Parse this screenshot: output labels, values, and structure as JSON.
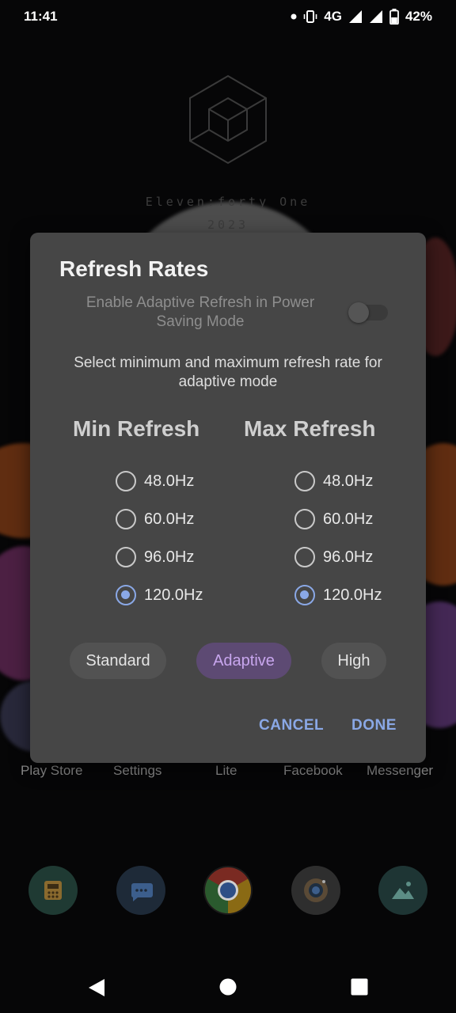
{
  "status_bar": {
    "time": "11:41",
    "network": "4G",
    "battery": "42%"
  },
  "wallpaper": {
    "line1": "Eleven:forty One",
    "line2": "2023"
  },
  "home": {
    "app_labels": [
      "Play Store",
      "Settings",
      "Lite",
      "Facebook",
      "Messenger"
    ],
    "dock_icons": [
      "phone-icon",
      "messages-icon",
      "chrome-icon",
      "camera-icon",
      "gallery-icon"
    ]
  },
  "dialog": {
    "title": "Refresh Rates",
    "adaptive_toggle_label": "Enable Adaptive Refresh in Power Saving Mode",
    "adaptive_toggle_on": false,
    "description": "Select minimum and maximum refresh rate for adaptive mode",
    "min_heading": "Min Refresh",
    "max_heading": "Max Refresh",
    "min_options": [
      {
        "label": "48.0Hz",
        "checked": false
      },
      {
        "label": "60.0Hz",
        "checked": false
      },
      {
        "label": "96.0Hz",
        "checked": false
      },
      {
        "label": "120.0Hz",
        "checked": true
      }
    ],
    "max_options": [
      {
        "label": "48.0Hz",
        "checked": false
      },
      {
        "label": "60.0Hz",
        "checked": false
      },
      {
        "label": "96.0Hz",
        "checked": false
      },
      {
        "label": "120.0Hz",
        "checked": true
      }
    ],
    "modes": [
      {
        "label": "Standard",
        "selected": false
      },
      {
        "label": "Adaptive",
        "selected": true
      },
      {
        "label": "High",
        "selected": false
      }
    ],
    "cancel_label": "CANCEL",
    "done_label": "DONE"
  },
  "colors": {
    "accent": "#8aa8e6",
    "chip_selected_bg": "#5d4a73",
    "chip_selected_text": "#c8a6ee",
    "dialog_bg": "#464646"
  }
}
